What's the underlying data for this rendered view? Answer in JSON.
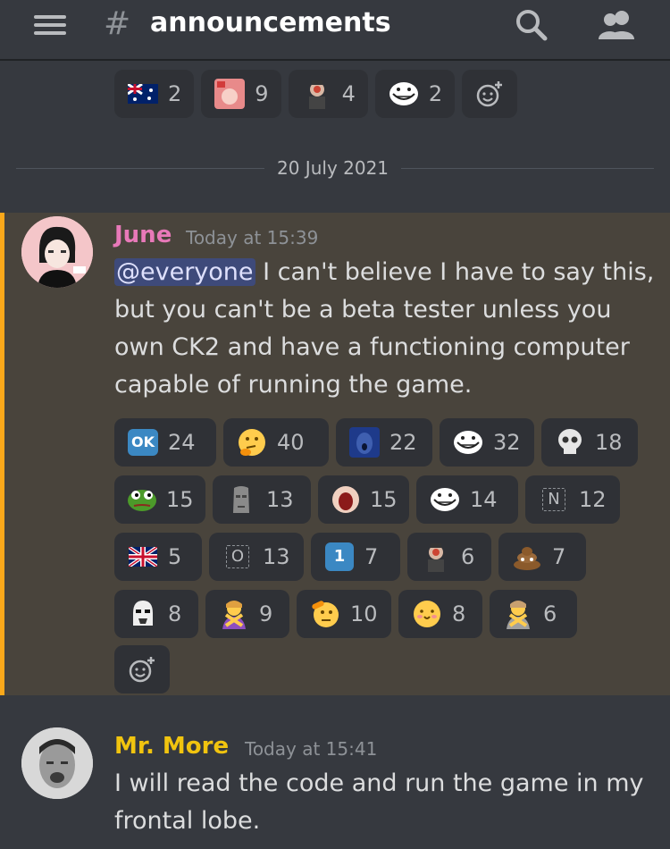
{
  "header": {
    "channel_name": "announcements",
    "hash": "#"
  },
  "top_reactions": [
    {
      "icon": "australia-flag-icon",
      "count": "2"
    },
    {
      "icon": "anime-girl-emoji-icon",
      "count": "9"
    },
    {
      "icon": "king-emoji-icon",
      "count": "4"
    },
    {
      "icon": "trollface-emoji-icon",
      "count": "2"
    }
  ],
  "divider": {
    "date": "20 July 2021"
  },
  "messages": [
    {
      "author": "June",
      "author_color": "#e879b9",
      "timestamp": "Today at 15:39",
      "mention": "@everyone",
      "text": " I can't believe I have to say this, but you can't be a beta tester unless you own CK2 and have a functioning computer capable of running the game.",
      "reactions": [
        [
          {
            "icon": "ok-button-icon",
            "glyph": "OK",
            "count": "24"
          },
          {
            "icon": "thinking-face-icon",
            "glyph": "🤔",
            "count": "40"
          },
          {
            "icon": "blue-scream-emoji-icon",
            "glyph": "",
            "count": "22"
          },
          {
            "icon": "trollface-emoji-icon",
            "glyph": "",
            "count": "32"
          },
          {
            "icon": "skull-icon",
            "glyph": "💀",
            "count": "18"
          }
        ],
        [
          {
            "icon": "pepe-frog-icon",
            "glyph": "",
            "count": "15"
          },
          {
            "icon": "moai-icon",
            "glyph": "🗿",
            "count": "13"
          },
          {
            "icon": "screaming-emoji-icon",
            "glyph": "",
            "count": "15"
          },
          {
            "icon": "trollface-emoji-icon",
            "glyph": "",
            "count": "14"
          },
          {
            "icon": "letter-n-icon",
            "glyph": "N",
            "count": "12"
          }
        ],
        [
          {
            "icon": "uk-flag-icon",
            "glyph": "",
            "count": "5"
          },
          {
            "icon": "letter-o-icon",
            "glyph": "O",
            "count": "13"
          },
          {
            "icon": "keycap-one-icon",
            "glyph": "1",
            "count": "7"
          },
          {
            "icon": "king-emoji-icon",
            "glyph": "",
            "count": "6"
          },
          {
            "icon": "poop-icon",
            "glyph": "💩",
            "count": "7"
          }
        ],
        [
          {
            "icon": "stormtrooper-emoji-icon",
            "glyph": "",
            "count": "8"
          },
          {
            "icon": "person-gesturing-no-icon",
            "glyph": "🙅",
            "count": "9"
          },
          {
            "icon": "saluting-face-icon",
            "glyph": "",
            "count": "10"
          },
          {
            "icon": "pleading-face-icon",
            "glyph": "",
            "count": "8"
          },
          {
            "icon": "person-gesturing-no-icon",
            "glyph": "🙅",
            "count": "6"
          }
        ]
      ]
    },
    {
      "author": "Mr. More",
      "author_color": "#f1c40f",
      "timestamp": "Today at 15:41",
      "text": "I will read the code and run the game in my frontal lobe."
    }
  ]
}
